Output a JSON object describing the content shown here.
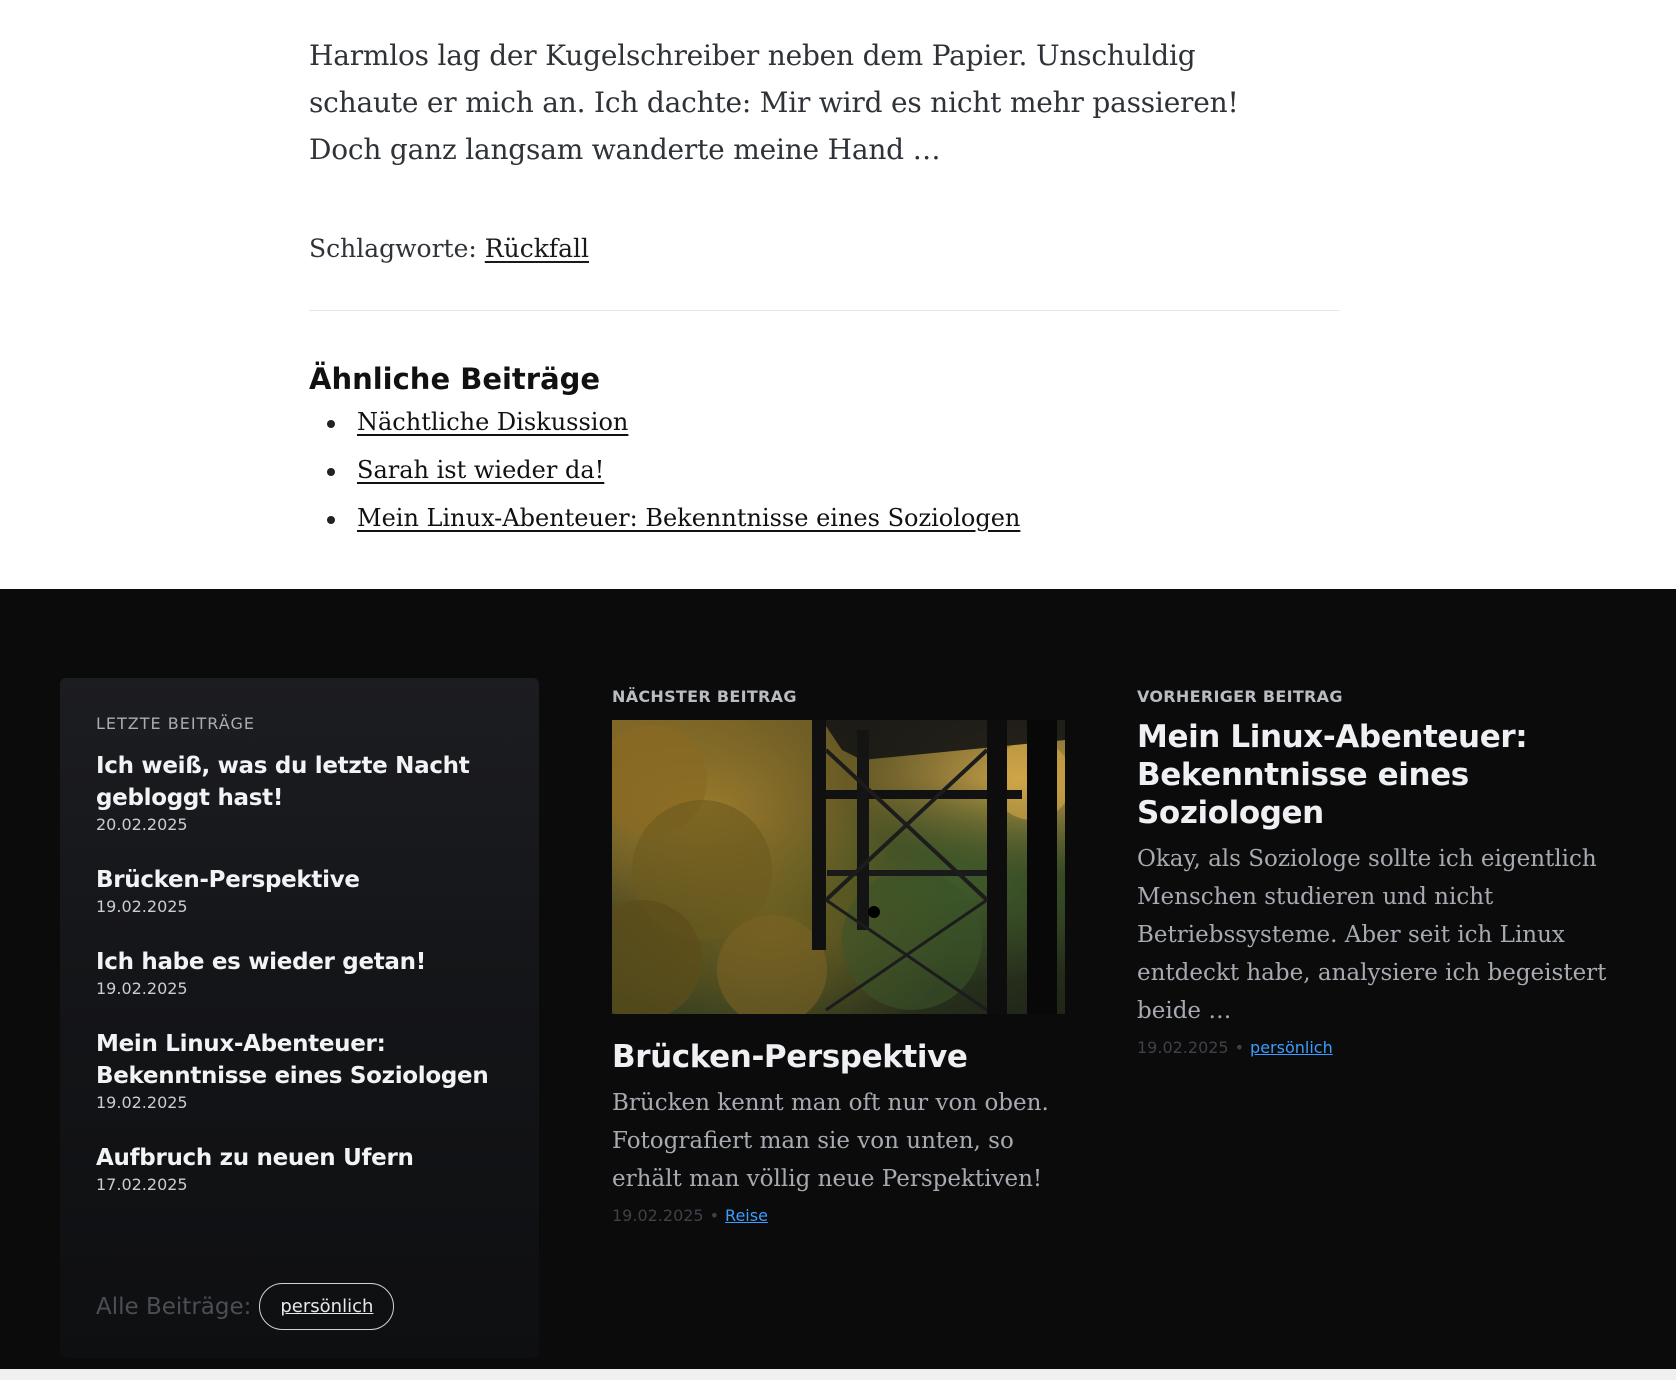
{
  "article": {
    "excerpt": "Harmlos lag der Kugelschreiber neben dem Papier. Unschuldig schaute er mich an. Ich dachte: Mir wird es nicht mehr passieren! Doch ganz langsam wanderte meine Hand …",
    "tags_label": "Schlagworte:",
    "tag": "Rückfall"
  },
  "related": {
    "title": "Ähnliche Beiträge",
    "items": [
      "Nächtliche Diskussion",
      "Sarah ist wieder da!",
      "Mein Linux-Abenteuer: Bekenntnisse eines Soziologen"
    ]
  },
  "recent": {
    "heading": "LETZTE BEITRÄGE",
    "items": [
      {
        "title": "Ich weiß, was du letzte Nacht gebloggt hast!",
        "date": "20.02.2025"
      },
      {
        "title": "Brücken-Perspektive",
        "date": "19.02.2025"
      },
      {
        "title": "Ich habe es wieder getan!",
        "date": "19.02.2025"
      },
      {
        "title": "Mein Linux-Abenteuer: Bekenntnisse eines Soziologen",
        "date": "19.02.2025"
      },
      {
        "title": "Aufbruch zu neuen Ufern",
        "date": "17.02.2025"
      }
    ],
    "all_label": "Alle Beiträge:",
    "all_tag": "persönlich"
  },
  "next_post": {
    "kicker": "NÄCHSTER BEITRAG",
    "title": "Brücken-Perspektive",
    "excerpt": "Brücken kennt man oft nur von oben. Fotografiert man sie von unten, so erhält man völlig neue Perspektiven!",
    "date": "19.02.2025",
    "category": "Reise"
  },
  "prev_post": {
    "kicker": "VORHERIGER BEITRAG",
    "title": "Mein Linux-Abenteuer: Bekenntnisse eines Soziologen",
    "excerpt": "Okay, als Soziologe sollte ich eigentlich Menschen studieren und nicht Betriebssysteme. Aber seit ich Linux entdeckt habe, analysiere ich begeistert beide …",
    "date": "19.02.2025",
    "category": "persönlich"
  },
  "colors": {
    "footer_bg": "#0b0b0c",
    "link_accent": "#3b9dff"
  }
}
